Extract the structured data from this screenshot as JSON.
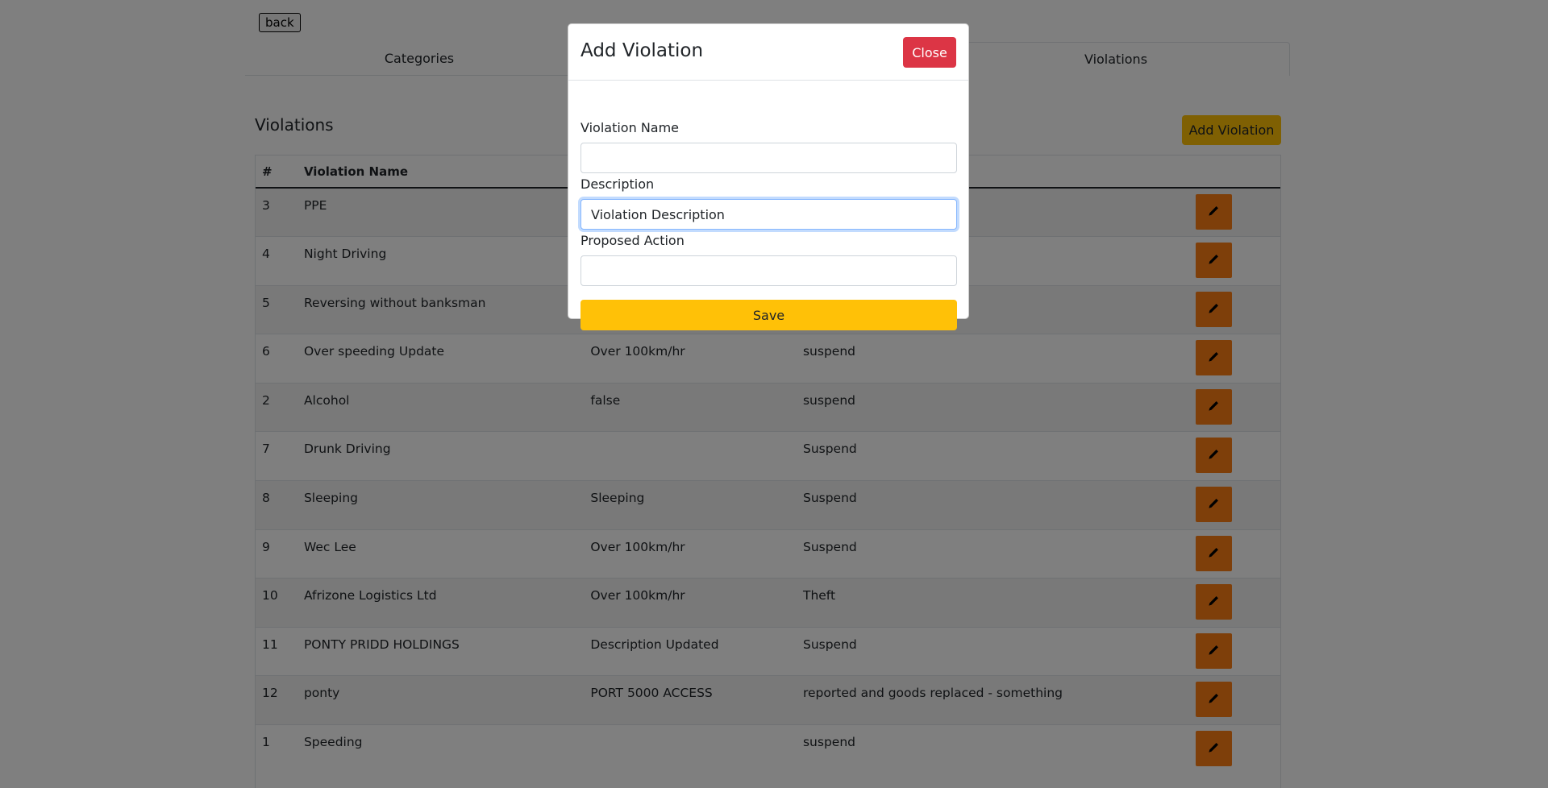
{
  "page": {
    "back_label": "back",
    "tabs": [
      {
        "label": "Categories"
      },
      {
        "label": "Violations"
      }
    ],
    "section_title": "Violations",
    "add_button_label": "Add Violation"
  },
  "table": {
    "headers": {
      "num": "#",
      "name": "Violation Name",
      "description": "",
      "action": "",
      "edit": ""
    },
    "rows": [
      {
        "id": "3",
        "name": "PPE",
        "description": "",
        "action": ""
      },
      {
        "id": "4",
        "name": "Night Driving",
        "description": "",
        "action": ""
      },
      {
        "id": "5",
        "name": "Reversing without banksman",
        "description": "",
        "action": ""
      },
      {
        "id": "6",
        "name": "Over speeding Update",
        "description": "Over 100km/hr",
        "action": "suspend"
      },
      {
        "id": "2",
        "name": "Alcohol",
        "description": "false",
        "action": "suspend"
      },
      {
        "id": "7",
        "name": "Drunk Driving",
        "description": "",
        "action": "Suspend"
      },
      {
        "id": "8",
        "name": "Sleeping",
        "description": "Sleeping",
        "action": "Suspend"
      },
      {
        "id": "9",
        "name": "Wec Lee",
        "description": "Over 100km/hr",
        "action": "Suspend"
      },
      {
        "id": "10",
        "name": "Afrizone Logistics Ltd",
        "description": "Over 100km/hr",
        "action": "Theft"
      },
      {
        "id": "11",
        "name": "PONTY PRIDD HOLDINGS",
        "description": "Description Updated",
        "action": "Suspend"
      },
      {
        "id": "12",
        "name": "ponty",
        "description": "PORT 5000 ACCESS",
        "action": "reported and goods replaced - something"
      },
      {
        "id": "1",
        "name": "Speeding",
        "description": "",
        "action": "suspend"
      }
    ],
    "edit_icon": "pencil-icon"
  },
  "modal": {
    "title": "Add Violation",
    "close_label": "Close",
    "fields": {
      "name": {
        "label": "Violation Name",
        "value": ""
      },
      "description": {
        "label": "Description",
        "value": "Violation Description"
      },
      "action": {
        "label": "Proposed Action",
        "value": ""
      }
    },
    "save_label": "Save"
  },
  "colors": {
    "warning": "#ffc107",
    "danger": "#dc3545",
    "edit": "#fd7e14"
  }
}
